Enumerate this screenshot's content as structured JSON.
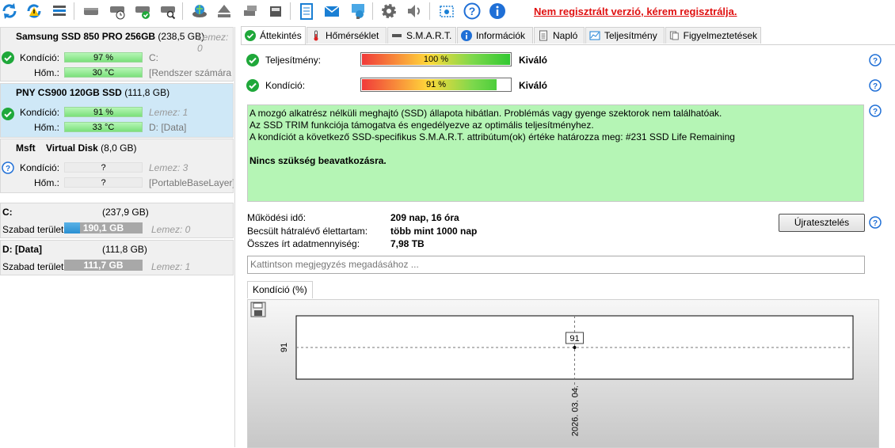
{
  "toolbar": {
    "icons": [
      "refresh-icon",
      "refresh-warning-icon",
      "drive-list-icon",
      "drive-icon",
      "drive-clock-icon",
      "drive-check-icon",
      "drive-search-icon",
      "disk-globe-icon",
      "eject-icon",
      "drives-icon",
      "drive-stack-icon",
      "notepad-icon",
      "email-icon",
      "network-icon",
      "settings-icon",
      "speaker-icon",
      "screenshot-icon",
      "help-icon",
      "info-icon"
    ],
    "unregistered_text": "Nem regisztrált verzió, kérem regisztrálja."
  },
  "disks": [
    {
      "name_bold": "Samsung SSD 850 PRO 256GB",
      "size": "(238,5 GB)",
      "lemez": "Lemez: 0",
      "status": "ok",
      "condition_label": "Kondíció:",
      "condition": "97 %",
      "condition_pct": 97,
      "temp_label": "Hőm.:",
      "temp": "30 °C",
      "side1": "C:",
      "side2": "[Rendszer számára f"
    },
    {
      "name_bold": "PNY CS900 120GB SSD",
      "size": "(111,8 GB)",
      "lemez": "",
      "status": "ok",
      "condition_label": "Kondíció:",
      "condition": "91 %",
      "condition_pct": 91,
      "temp_label": "Hőm.:",
      "temp": "33 °C",
      "side1": "Lemez: 1",
      "side2": "D: [Data]"
    },
    {
      "name_bold": "Msft",
      "name_rest": "Virtual Disk",
      "size": "(8,0 GB)",
      "lemez": "",
      "status": "unknown",
      "condition_label": "Kondíció:",
      "condition": "?",
      "temp_label": "Hőm.:",
      "temp": "?",
      "side1": "Lemez: 3",
      "side2": "[PortableBaseLayer]"
    }
  ],
  "volumes": [
    {
      "name": "C:",
      "size": "(237,9 GB)",
      "free_label": "Szabad terület",
      "free": "190,1 GB",
      "free_pct": 80,
      "lemez": "Lemez: 0"
    },
    {
      "name": "D: [Data]",
      "size": "(111,8 GB)",
      "free_label": "Szabad terület",
      "free": "111,7 GB",
      "free_pct": 0,
      "lemez": "Lemez: 1"
    }
  ],
  "tabs": [
    "Áttekintés",
    "Hőmérséklet",
    "S.M.A.R.T.",
    "Információk",
    "Napló",
    "Teljesítmény",
    "Figyelmeztetések"
  ],
  "overview": {
    "performance_label": "Teljesítmény:",
    "performance_value": "100 %",
    "performance_pct": 100,
    "performance_rating": "Kiváló",
    "condition_label": "Kondíció:",
    "condition_value": "91 %",
    "condition_pct": 91,
    "condition_rating": "Kiváló",
    "message_lines": [
      "A mozgó alkatrész nélküli meghajtó (SSD) állapota hibátlan. Problémás vagy gyenge szektorok nem találhatóak.",
      "Az SSD TRIM funkciója támogatva és engedélyezve az optimális teljesítményhez.",
      "A kondíciót a következő SSD-specifikus S.M.A.R.T. attribútum(ok) értéke határozza meg:  #231 SSD Life Remaining"
    ],
    "message_action": "Nincs szükség beavatkozásra.",
    "uptime_label": "Működési idő:",
    "uptime_value": "209 nap, 16 óra",
    "lifetime_label": "Becsült hátralévő élettartam:",
    "lifetime_value": "több mint 1000 nap",
    "written_label": "Összes írt adatmennyiség:",
    "written_value": "7,98 TB",
    "retest_button": "Újratesztelés",
    "comment_placeholder": "Kattintson megjegyzés megadásához ..."
  },
  "chart_tab": "Kondíció  (%)",
  "chart_data": {
    "type": "line",
    "x": [
      "2026. 03. 04."
    ],
    "series": [
      {
        "values": [
          91
        ]
      }
    ],
    "point_labels": [
      "91"
    ],
    "ytick_labels": [
      "91"
    ],
    "xtick_labels": [
      "2026. 03. 04."
    ],
    "grid": true
  },
  "colors": {
    "accent_red": "#e01010",
    "ok_green": "#1fa83a",
    "help_blue": "#1f6fd6",
    "message_bg": "#b5f5b5"
  }
}
